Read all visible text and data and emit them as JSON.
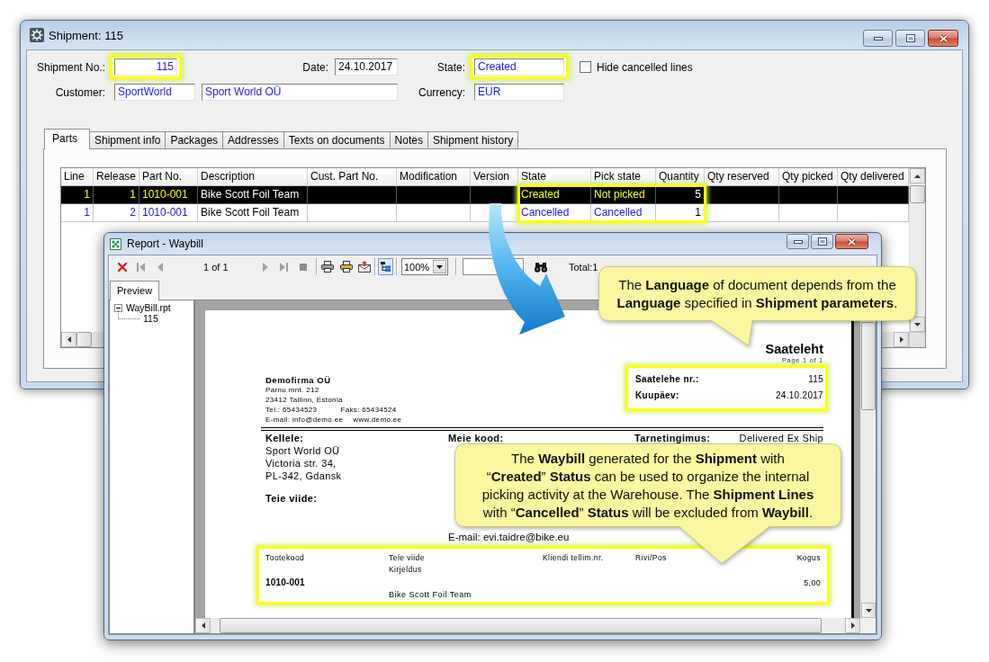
{
  "shipment_window": {
    "title": "Shipment: 115",
    "form": {
      "shipment_no": {
        "label": "Shipment No.:",
        "value": "115",
        "editable": false,
        "highlighted": true
      },
      "date": {
        "label": "Date:",
        "value": "24.10.2017",
        "editable": true
      },
      "state": {
        "label": "State:",
        "value": "Created",
        "editable": false,
        "highlighted": true
      },
      "hide_cancelled_lines": {
        "label": "Hide cancelled lines",
        "checked": false
      },
      "customer": {
        "label": "Customer:",
        "code": "SportWorld",
        "name": "Sport World OÜ",
        "editable": false
      },
      "currency": {
        "label": "Currency:",
        "value": "EUR",
        "editable": false
      }
    },
    "tabs": [
      {
        "label": "Parts",
        "selected": true
      },
      {
        "label": "Shipment info",
        "selected": false
      },
      {
        "label": "Packages",
        "selected": false
      },
      {
        "label": "Addresses",
        "selected": false
      },
      {
        "label": "Texts on documents",
        "selected": false
      },
      {
        "label": "Notes",
        "selected": false
      },
      {
        "label": "Shipment history",
        "selected": false
      }
    ],
    "table": {
      "columns": [
        {
          "label": "Line",
          "highlighted": false
        },
        {
          "label": "Release",
          "highlighted": false
        },
        {
          "label": "Part No.",
          "highlighted": false
        },
        {
          "label": "Description",
          "highlighted": false
        },
        {
          "label": "Cust. Part No.",
          "highlighted": false
        },
        {
          "label": "Modification",
          "highlighted": false
        },
        {
          "label": "Version",
          "highlighted": false
        },
        {
          "label": "State",
          "highlighted": true
        },
        {
          "label": "Pick state",
          "highlighted": true
        },
        {
          "label": "Quantity",
          "highlighted": true
        },
        {
          "label": "Qty reserved",
          "highlighted": false
        },
        {
          "label": "Qty picked",
          "highlighted": false
        },
        {
          "label": "Qty delivered",
          "highlighted": false
        }
      ],
      "rows": [
        {
          "selected": true,
          "cells": [
            {
              "text": "1",
              "readonly": true
            },
            {
              "text": "1",
              "readonly": true
            },
            {
              "text": "1010-001",
              "readonly": true
            },
            {
              "text": "Bike Scott Foil Team",
              "readonly": false
            },
            null,
            null,
            null,
            {
              "text": "Created",
              "readonly": true
            },
            {
              "text": "Not picked",
              "readonly": true
            },
            {
              "text": "5",
              "readonly": false
            },
            null,
            null,
            null
          ]
        },
        {
          "selected": false,
          "cells": [
            {
              "text": "1",
              "readonly": true
            },
            {
              "text": "2",
              "readonly": true
            },
            {
              "text": "1010-001",
              "readonly": true
            },
            {
              "text": "Bike Scott Foil Team",
              "readonly": false
            },
            null,
            null,
            null,
            {
              "text": "Cancelled",
              "readonly": true
            },
            {
              "text": "Cancelled",
              "readonly": true
            },
            {
              "text": "1",
              "readonly": false
            },
            null,
            null,
            null
          ]
        }
      ]
    }
  },
  "report_window": {
    "title": "Report - Waybill",
    "toolbar": {
      "page_indicator": "1 of 1",
      "zoom": "100%",
      "total": "Total:1"
    },
    "side_tab": {
      "label": "Preview",
      "selected": true
    },
    "tree": [
      {
        "label": "WayBill.rpt",
        "expanded": true,
        "children": [
          {
            "label": "115"
          }
        ]
      }
    ],
    "document": {
      "title": "Saateleht",
      "page_info": "Page 1 of 1",
      "company": {
        "name": "Demofirma OÜ",
        "address": [
          "Parnu mnt. 212",
          "23412 Tallinn, Estonia"
        ],
        "phone": "Tel.: 65434523",
        "fax": "Faks: 65434524",
        "email": "E-mail: info@demo.ee",
        "website": "www.demo.ee"
      },
      "header_box": {
        "highlighted": true,
        "rows": [
          {
            "label": "Saatelehe nr.:",
            "value": "115"
          },
          {
            "label": "Kuupäev:",
            "value": "24.10.2017"
          }
        ]
      },
      "recipient": {
        "label": "Kellele:",
        "lines": [
          "Sport World OÜ",
          "Victoria str. 34,",
          "PL-342, Gdansk"
        ]
      },
      "reference_label": "Teie viide:",
      "our_code_label": "Meie kood:",
      "contact_email": "E-mail: evi.taidre@bike.eu",
      "delivery_terms": {
        "label": "Tarnetingimus:",
        "value": "Delivered Ex Ship"
      },
      "lines_table": {
        "highlighted": true,
        "columns": [
          "Tootekood",
          "Teie viide",
          "Kliendi tellim.nr.",
          "Rivi/Pos",
          "Kogus"
        ],
        "description_header": "Kirjeldus",
        "rows": [
          {
            "code": "1010-001",
            "quantity": "5,00",
            "description": "Bike Scott Foil Team"
          }
        ]
      }
    }
  },
  "callouts": [
    {
      "text": "The **Language** of document depends from the\n**Language** specified in **Shipment parameters**."
    },
    {
      "text": "The **Waybill** generated for the **Shipment** with\n“**Created**” **Status** can be used to organize the internal\npicking activity at the Warehouse. The **Shipment Lines**\nwith “**Cancelled**” **Status** will be excluded from **Waybill**."
    }
  ]
}
